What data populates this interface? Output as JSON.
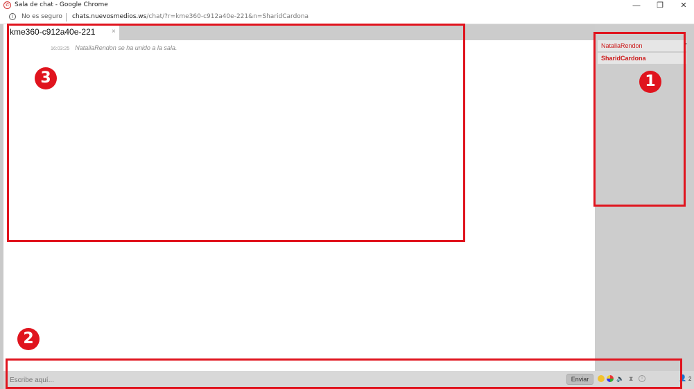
{
  "window": {
    "title": "Sala de chat - Google Chrome",
    "minimize_glyph": "—",
    "restore_glyph": "❐",
    "close_glyph": "✕"
  },
  "addressbar": {
    "security_label": "No es seguro",
    "url_host": "chats.nuevosmedios.ws",
    "url_rest": "/chat/?r=kme360-c912a40e-221&n=SharidCardona"
  },
  "tab": {
    "title": "kme360-c912a40e-221",
    "close_glyph": "×"
  },
  "messages": [
    {
      "time": "16:03:25",
      "text": "NataliaRendon se ha unido a la sala."
    }
  ],
  "users": [
    {
      "name": "NataliaRendon"
    },
    {
      "name": "SharidCardona"
    }
  ],
  "input": {
    "placeholder": "Escribe aquí...",
    "send_label": "Enviar"
  },
  "toolbar": {
    "icons": [
      "emoji-icon",
      "color-icon",
      "sound-icon",
      "timer-icon",
      "info-icon",
      "users-icon"
    ],
    "users_count": "2"
  },
  "annotations": [
    {
      "label": "1",
      "color": "#e0141e"
    },
    {
      "label": "2",
      "color": "#e0141e"
    },
    {
      "label": "3",
      "color": "#e0141e"
    }
  ]
}
